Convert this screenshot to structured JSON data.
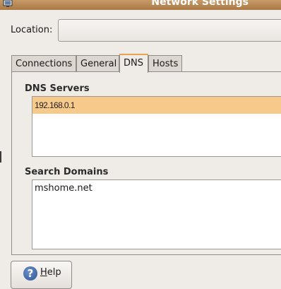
{
  "window": {
    "title": "Network Settings",
    "icon": "network-computer-icon"
  },
  "location": {
    "label": "Location:",
    "value": ""
  },
  "tabs": [
    {
      "label": "Connections",
      "active": false
    },
    {
      "label": "General",
      "active": false
    },
    {
      "label": "DNS",
      "active": true
    },
    {
      "label": "Hosts",
      "active": false
    }
  ],
  "dns": {
    "servers_title": "DNS Servers",
    "servers": [
      "192.168.0.1"
    ],
    "domains_title": "Search Domains",
    "domains": [
      "mshome.net"
    ]
  },
  "help_button": {
    "mnemonic": "H",
    "rest": "elp",
    "icon": "help-icon"
  },
  "colors": {
    "selection": "#f7c98b",
    "active_tab_accent": "#e9a24b",
    "titlebar": "#b5864f"
  }
}
